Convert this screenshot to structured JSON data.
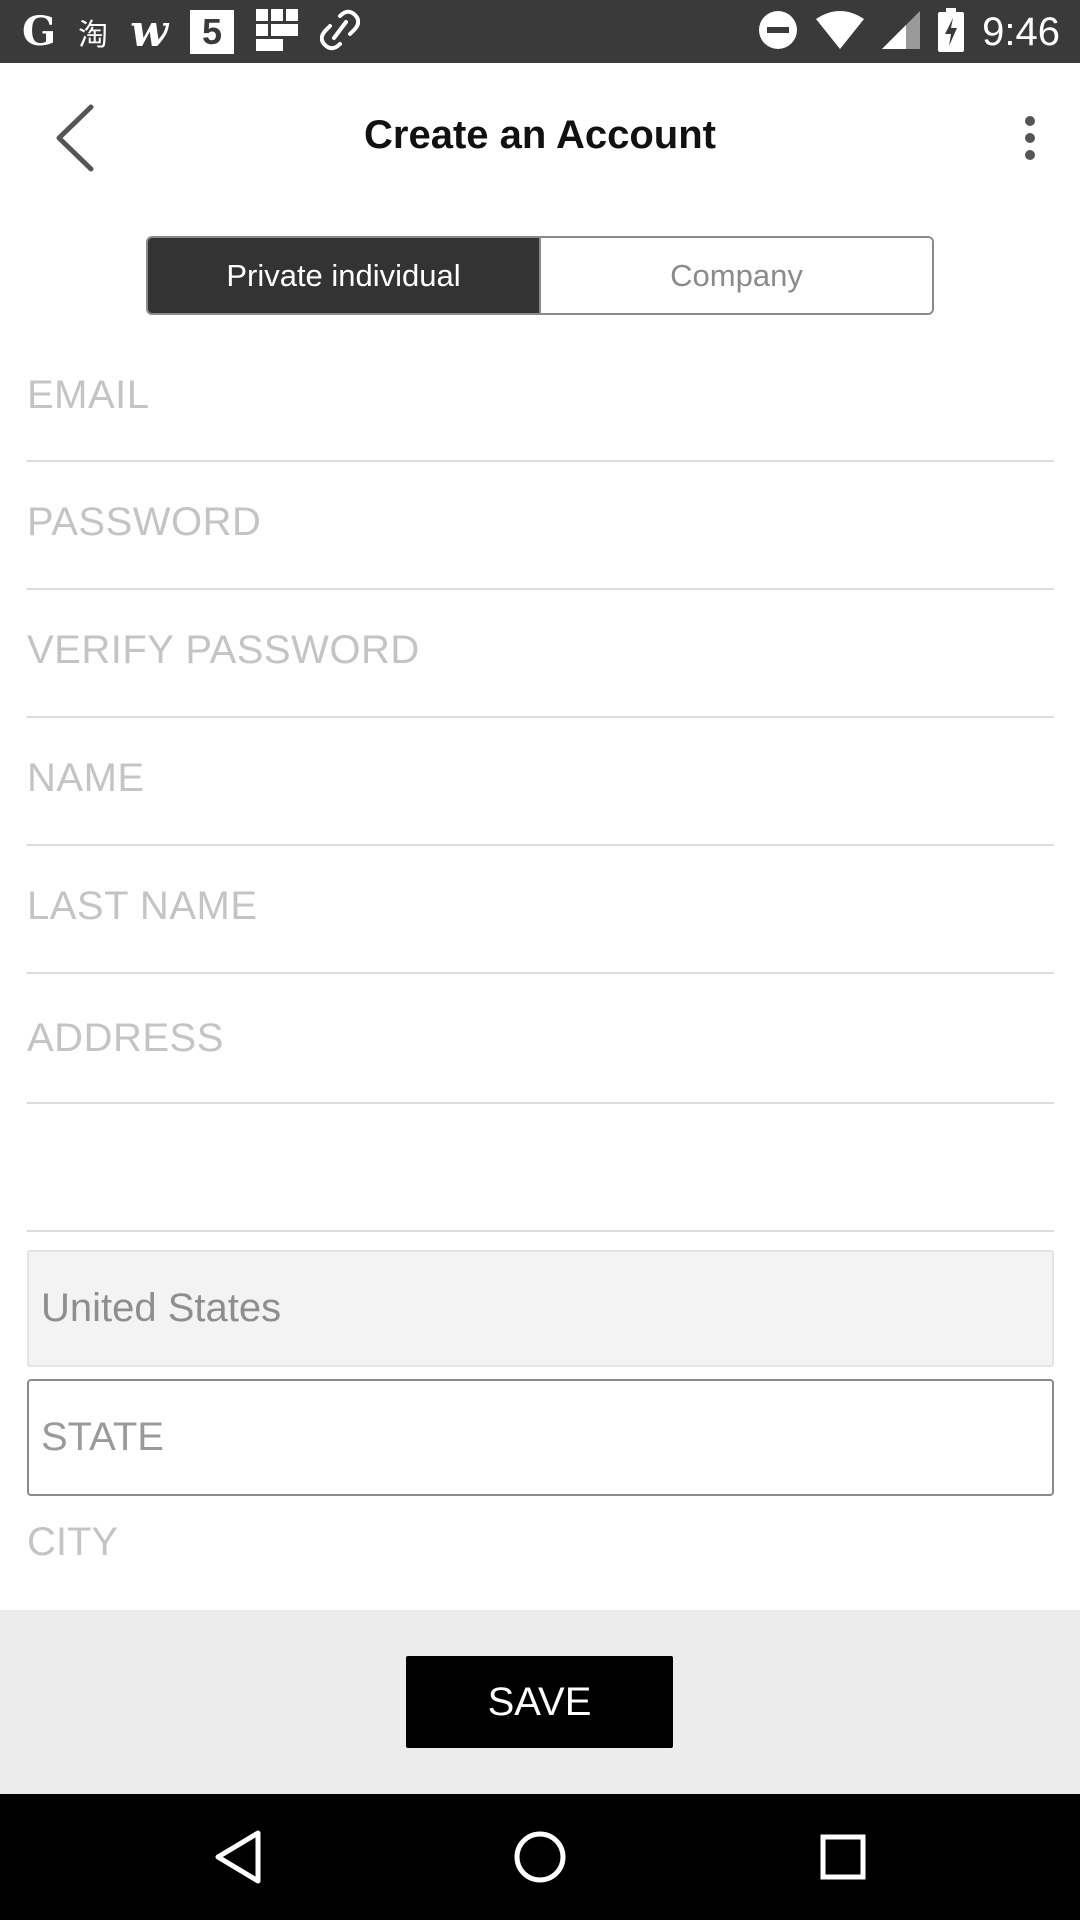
{
  "status_bar": {
    "left_icons": [
      {
        "name": "google-icon",
        "glyph": "G"
      },
      {
        "name": "taobao-icon",
        "glyph": "淘"
      },
      {
        "name": "w-app-icon",
        "glyph": "w"
      },
      {
        "name": "html5-icon",
        "glyph": "5"
      },
      {
        "name": "grid-app-icon"
      },
      {
        "name": "link-icon"
      }
    ],
    "right_icons": [
      "do-not-disturb-icon",
      "wifi-icon",
      "signal-icon",
      "battery-charging-icon"
    ],
    "time": "9:46"
  },
  "header": {
    "title": "Create an Account"
  },
  "account_type": {
    "options": [
      {
        "label": "Private individual",
        "active": true
      },
      {
        "label": "Company",
        "active": false
      }
    ]
  },
  "form": {
    "email_placeholder": "EMAIL",
    "password_placeholder": "PASSWORD",
    "verify_password_placeholder": "VERIFY PASSWORD",
    "name_placeholder": "NAME",
    "last_name_placeholder": "LAST NAME",
    "address_placeholder": "ADDRESS",
    "address2_placeholder": "",
    "country_value": "United States",
    "state_placeholder": "STATE",
    "city_placeholder": "CITY"
  },
  "footer": {
    "save_label": "SAVE"
  },
  "colors": {
    "status_bar_bg": "#3a3a3a",
    "active_segment_bg": "#333333",
    "save_button_bg": "#000000",
    "footer_bg": "#ececec"
  }
}
